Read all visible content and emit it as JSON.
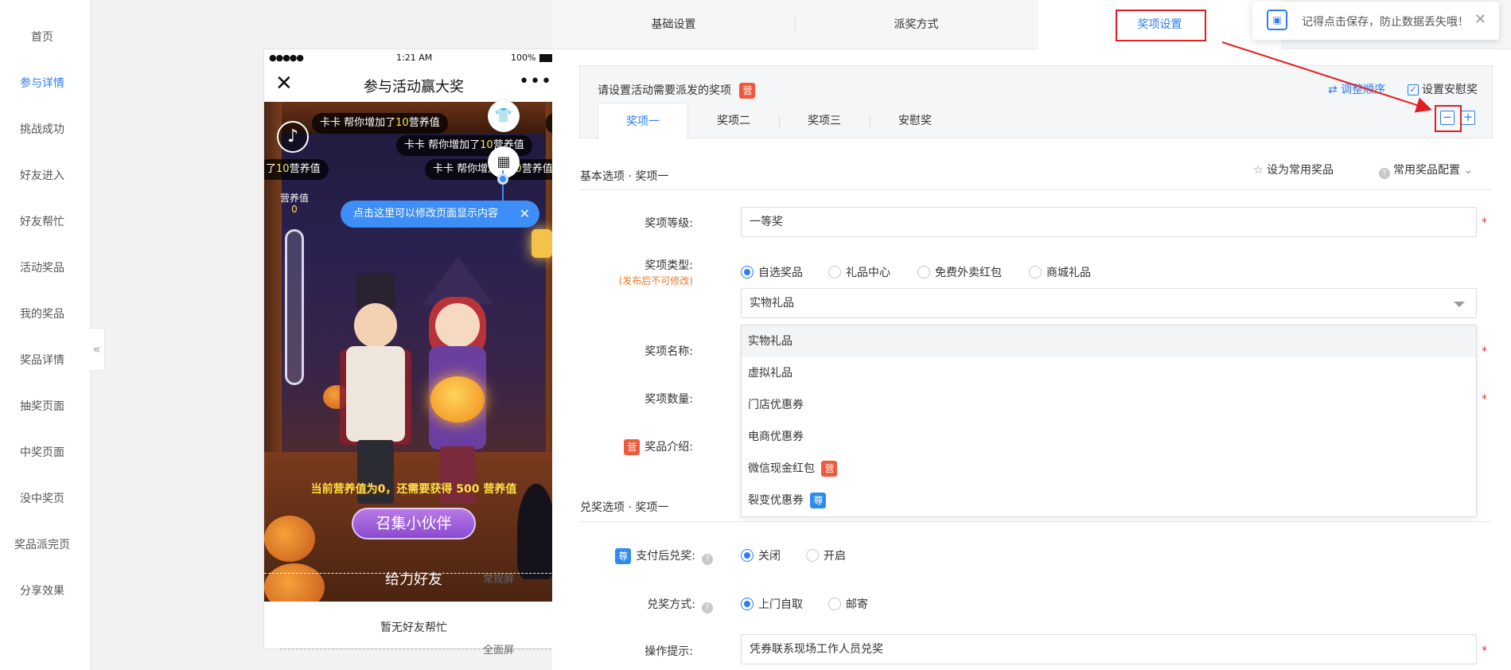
{
  "nav": {
    "items": [
      {
        "label": "首页"
      },
      {
        "label": "参与详情"
      },
      {
        "label": "挑战成功"
      },
      {
        "label": "好友进入"
      },
      {
        "label": "好友帮忙"
      },
      {
        "label": "活动奖品"
      },
      {
        "label": "我的奖品"
      },
      {
        "label": "奖品详情"
      },
      {
        "label": "抽奖页面"
      },
      {
        "label": "中奖页面"
      },
      {
        "label": "没中奖页"
      },
      {
        "label": "奖品派完页"
      },
      {
        "label": "分享效果"
      }
    ],
    "active_index": 1,
    "collapse_icon": "«"
  },
  "phone": {
    "status": {
      "signal": "●●●●●",
      "time": "1:21 AM",
      "battery": "100%"
    },
    "title": "参与活动赢大奖",
    "close_icon": "✕",
    "more_icon": "•••",
    "tickers": [
      {
        "prefix": "卡卡 帮你增加了",
        "num": "10",
        "suffix": "营养值"
      },
      {
        "prefix": "卡卡 帮你增加了",
        "num": "10",
        "suffix": "营养值"
      },
      {
        "prefix": "了",
        "num": "10",
        "suffix": "营养值"
      },
      {
        "prefix": "卡卡 帮你增加了",
        "num": "10",
        "suffix": "营养值"
      },
      {
        "prefix": "卡",
        "num": "",
        "suffix": ""
      }
    ],
    "nutrition_label": "营养值",
    "nutrition_value": "0",
    "progress_text": "当前营养值为0，还需要获得 500 营养值",
    "summon_button": "召集小伙伴",
    "give_friends": "给力好友",
    "no_friends": "暂无好友帮忙"
  },
  "guides": {
    "normal_screen": "常规屏",
    "full_screen": "全面屏"
  },
  "tip_bubble": "点击这里可以修改页面显示内容",
  "tabs": {
    "items": [
      "基础设置",
      "派奖方式",
      "奖项设置"
    ],
    "selected_index": 2
  },
  "toast": {
    "message": "记得点击保存，防止数据丢失哦！",
    "close": "✕"
  },
  "prize_settings": {
    "heading": "请设置活动需要派发的奖项",
    "badge_ying": "营",
    "badge_zun": "尊",
    "reorder": "⇄ 调整顺序",
    "consolation_check": "设置安慰奖",
    "subtabs": [
      "奖项一",
      "奖项二",
      "奖项三",
      "安慰奖"
    ],
    "minus": "−",
    "plus": "+"
  },
  "basic": {
    "title": "基本选项 · 奖项一",
    "set_common": "设为常用奖品",
    "common_config": "常用奖品配置"
  },
  "form": {
    "level_label": "奖项等级:",
    "level_value": "一等奖",
    "type_label": "奖项类型:",
    "type_sub": "(发布后不可修改)",
    "type_options": [
      "自选奖品",
      "礼品中心",
      "免费外卖红包",
      "商城礼品"
    ],
    "gift_select": "实物礼品",
    "name_label": "奖项名称:",
    "qty_label": "奖项数量:",
    "intro_label": "奖品介绍:",
    "dropdown_options": [
      "实物礼品",
      "虚拟礼品",
      "门店优惠券",
      "电商优惠券",
      "微信现金红包",
      "裂变优惠券"
    ]
  },
  "redeem": {
    "title": "兑奖选项 · 奖项一",
    "pay_label": "支付后兑奖:",
    "pay_options": [
      "关闭",
      "开启"
    ],
    "method_label": "兑奖方式:",
    "method_options": [
      "上门自取",
      "邮寄"
    ],
    "tip_label": "操作提示:",
    "tip_value": "凭券联系现场工作人员兑奖"
  },
  "colors": {
    "accent": "#2e7cf6",
    "marker": "#e02020",
    "badge_ying": "#f05a3c",
    "badge_zun": "#2e8cf0"
  }
}
